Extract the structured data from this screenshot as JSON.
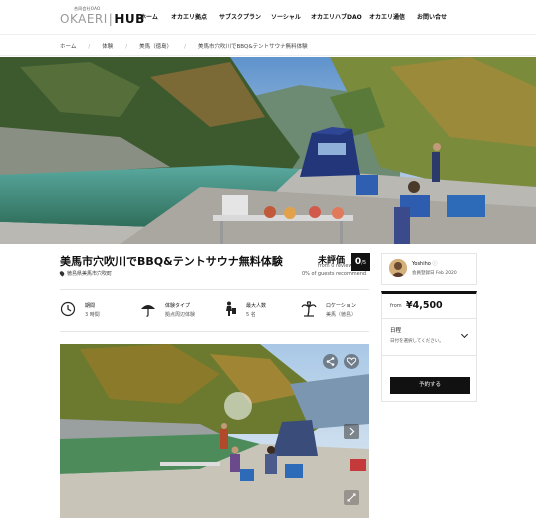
{
  "header": {
    "logo_small": "合同会社OAO",
    "logo_light": "OKAERI",
    "logo_bold": "HUB",
    "nav": [
      "ホーム",
      "オカエリ拠点",
      "サブスクプラン",
      "ソーシャル",
      "オカエリハブDAO",
      "オカエリ通信",
      "お問い合せ"
    ]
  },
  "breadcrumb": [
    "ホーム",
    "体験",
    "美馬（徳島）",
    "美馬市穴吹川でBBQ&テントサウナ無料体験"
  ],
  "listing": {
    "title": "美馬市穴吹川でBBQ&テントサウナ無料体験",
    "location": "徳島県美馬市穴吹町",
    "rating_label": "未評価",
    "reviews": "from 0 reviews",
    "recommend": "0% of guests recommend",
    "score": "0",
    "score_suffix": "/5"
  },
  "features": [
    {
      "icon": "clock-icon",
      "label": "期間",
      "value": "3 時間"
    },
    {
      "icon": "umbrella-icon",
      "label": "体験タイプ",
      "value": "拠点周辺体験"
    },
    {
      "icon": "traveler-icon",
      "label": "最大人数",
      "value": "5 名"
    },
    {
      "icon": "palm-tree-icon",
      "label": "ロケーション",
      "value": "美馬（徳島）"
    }
  ],
  "host": {
    "name": "Yoshiho",
    "since": "会員登録日 Feb 2020"
  },
  "booking": {
    "from": "from",
    "price": "¥4,500",
    "date_label": "日程",
    "date_hint": "日付を選択してください。",
    "reserve": "予約する"
  }
}
